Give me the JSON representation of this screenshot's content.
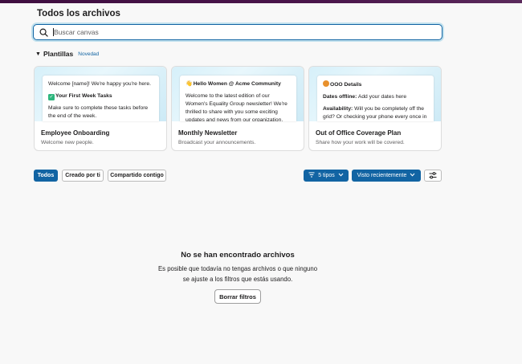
{
  "page_title": "Todos los archivos",
  "search": {
    "placeholder": "Buscar canvas",
    "value": ""
  },
  "templates": {
    "label": "Plantillas",
    "badge": "Novedad",
    "cards": [
      {
        "name": "Employee Onboarding",
        "desc": "Welcome new people.",
        "preview_line1": "Welcome [name]! We're happy you're here.",
        "preview_heading": "Your First Week Tasks",
        "preview_line2": "Make sure to complete these tasks before the end of the week."
      },
      {
        "name": "Monthly Newsletter",
        "desc": "Broadcast your announcements.",
        "preview_heading": "Hello Women @ Acme Community",
        "preview_line1": "Welcome to the latest edition of our Women's Equality Group newsletter! We're thrilled to share with you some exciting updates and news from our organization."
      },
      {
        "name": "Out of Office Coverage Plan",
        "desc": "Share how your work will be covered.",
        "preview_heading": "OOO Details",
        "preview_label1": "Dates offline:",
        "preview_text1": "Add your dates here",
        "preview_label2": "Availability:",
        "preview_text2": "Will you be completely off the grid? Or checking your phone every once in a while?"
      }
    ]
  },
  "filters": {
    "all": "Todos",
    "created_by_you": "Creado por ti",
    "shared_with_you": "Compartido contigo",
    "types": "5 tipos",
    "sort": "Visto recientemente"
  },
  "empty_state": {
    "title": "No se han encontrado archivos",
    "line1": "Es posible que todavía no tengas archivos o que ninguno",
    "line2": "se ajuste a los filtros que estás usando.",
    "button": "Borrar filtros"
  },
  "colors": {
    "accent": "#1264a3",
    "topbar": "#4a154b"
  }
}
